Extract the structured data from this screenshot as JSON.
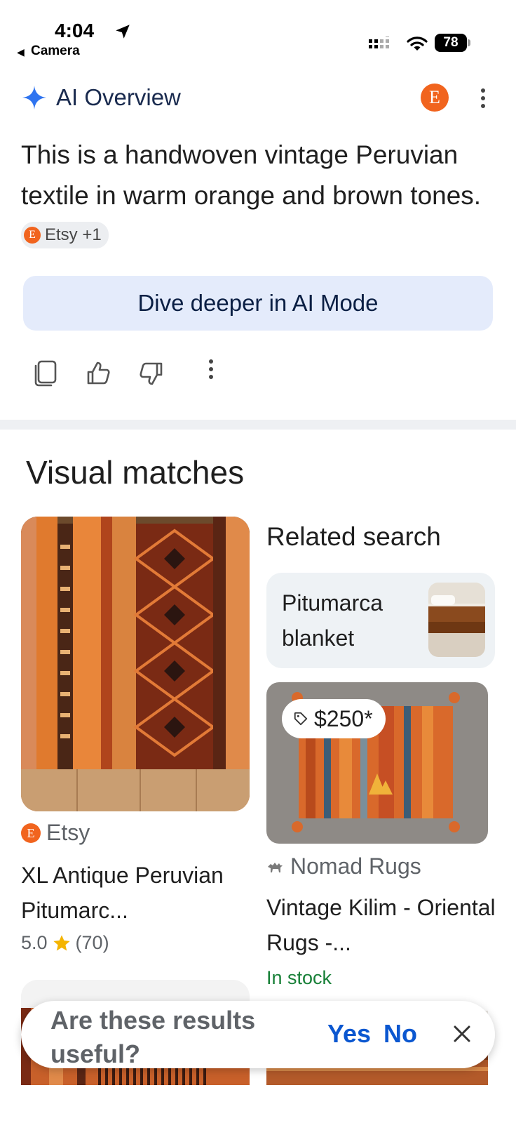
{
  "status_bar": {
    "time": "4:04",
    "back_label": "Camera",
    "battery": "78"
  },
  "ai_overview": {
    "title": "AI Overview",
    "source_badge": "E",
    "text": "This is a handwoven vintage Peruvian textile in warm orange and brown tones.",
    "source_chip": "Etsy +1",
    "dive_button": "Dive deeper in AI Mode"
  },
  "visual_matches": {
    "title": "Visual matches",
    "item1": {
      "source": "Etsy",
      "title": "XL Antique Peruvian Pitumarc...",
      "rating": "5.0",
      "reviews": "(70)"
    },
    "related": {
      "heading": "Related search",
      "query": "Pitumarca blanket"
    },
    "item2": {
      "price": "$250*",
      "source": "Nomad Rugs",
      "title": "Vintage Kilim - Oriental Rugs -...",
      "availability": "In stock"
    }
  },
  "feedback": {
    "question": "Are these results useful?",
    "yes": "Yes",
    "no": "No"
  },
  "colors": {
    "etsy_orange": "#f1641e",
    "accent_blue": "#0b57d0",
    "in_stock_green": "#188038",
    "dive_button_bg": "#e4ebfb"
  },
  "icons": [
    "location-arrow-icon",
    "signal-icon",
    "wifi-icon",
    "sparkle-icon",
    "more-vert-icon",
    "copy-icon",
    "thumbs-up-icon",
    "thumbs-down-icon",
    "star-icon",
    "tag-icon",
    "close-icon"
  ]
}
